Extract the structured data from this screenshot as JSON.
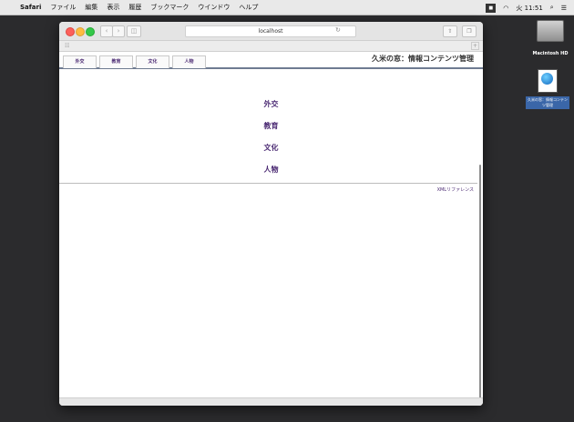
{
  "menubar": {
    "app": "Safari",
    "items": [
      "ファイル",
      "編集",
      "表示",
      "履歴",
      "ブックマーク",
      "ウインドウ",
      "ヘルプ"
    ],
    "clock": "火 11:51"
  },
  "browser": {
    "url": "localhost"
  },
  "page": {
    "title": "久米の窓：情報コンテンツ管理",
    "tabs": [
      "外交",
      "教育",
      "文化",
      "人物"
    ],
    "links": [
      "外交",
      "教育",
      "文化",
      "人物"
    ],
    "footer_link": "XMLリファレンス"
  },
  "desktop": {
    "hd_label": "Macintosh HD",
    "file_label": "久米の窓：情報コンテンツ管理"
  },
  "colors": {
    "link": "#4b2a73",
    "rule": "#6e7b91"
  }
}
